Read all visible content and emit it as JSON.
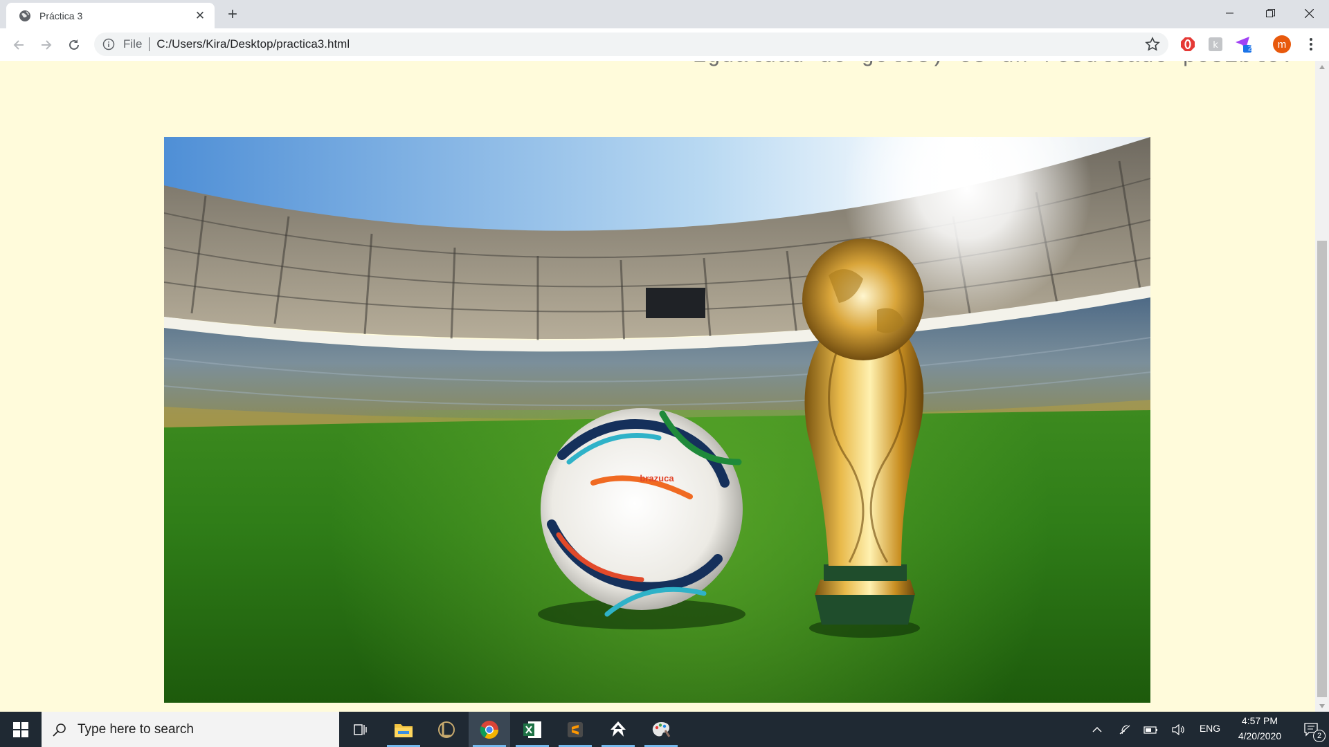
{
  "browser": {
    "tab_title": "Práctica 3",
    "omnibox_scheme": "File",
    "url": "C:/Users/Kira/Desktop/practica3.html",
    "profile_initial": "m",
    "extension_badge": "2"
  },
  "page": {
    "paragraph_tail": "igualdad de goles) es un resultado posible.",
    "hero_image": {
      "ball_brand_text": "brazuca"
    }
  },
  "taskbar": {
    "search_placeholder": "Type here to search",
    "language": "ENG",
    "time": "4:57 PM",
    "date": "4/20/2020",
    "notification_count": "2",
    "pinned_apps": [
      "task-view",
      "file-explorer",
      "league-of-legends",
      "chrome",
      "excel",
      "sublime-text",
      "inkscape",
      "paint"
    ]
  }
}
